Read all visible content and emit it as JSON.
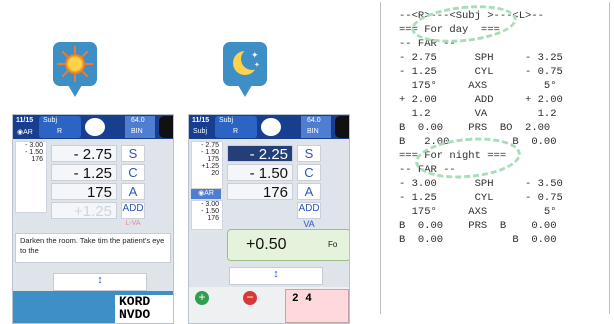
{
  "colors": {
    "accent": "#3d8fc6",
    "screen_bar": "#173e8f",
    "tab": "#2c64c6",
    "highlight": "#243e7a",
    "dash": "#a9ddb8"
  },
  "day_badge": {
    "icon": "sun-icon"
  },
  "night_badge": {
    "icon": "moon-icon"
  },
  "day_screen": {
    "date": "11/15",
    "tag": "◉AR",
    "subj": "Subj",
    "subj_r": "R",
    "bin_val": "64.0",
    "bin_label": "BIN",
    "ar_left": [
      "- 3.00",
      "- 1.50",
      "176"
    ],
    "rows": [
      {
        "value": "- 2.75",
        "label": "S"
      },
      {
        "value": "- 1.25",
        "label": "C"
      },
      {
        "value": "175",
        "label": "A"
      },
      {
        "value": "+1.25",
        "label": "ADD"
      }
    ],
    "va_label": "L-VA",
    "message": "Darken the room. Take tim the patient's eye to the",
    "arrow": "↕",
    "kord": "KORD",
    "nvdo": "NVDO"
  },
  "night_screen": {
    "date": "11/15",
    "subj": "Subj",
    "subj_r": "R",
    "bin_val": "64.0",
    "bin_label": "BIN",
    "subj_left": [
      "- 2.75",
      "- 1.50",
      "175",
      "+1.25",
      "20"
    ],
    "ar_tag": "◉AR",
    "ar_left": [
      "- 3.00",
      "- 1.50",
      "176"
    ],
    "rows": [
      {
        "value": "- 2.25",
        "label": "S"
      },
      {
        "value": "- 1.50",
        "label": "C"
      },
      {
        "value": "176",
        "label": "A"
      }
    ],
    "add_label": "ADD",
    "va_label": "VA",
    "add_value": "+0.50",
    "add_suffix": "Fo",
    "arrow": "↕",
    "plus": "+",
    "minus": "−",
    "chart_nums": "2 4"
  },
  "printout": {
    "header": "--<R>---<Subj >---<L>--",
    "day_title": "=== For day  ===",
    "far": "-- FAR --",
    "day_lines": [
      "- 2.75      SPH     - 3.25",
      "- 1.25      CYL     - 0.75",
      "  175°     AXS         5°",
      "+ 2.00      ADD     + 2.00",
      "  1.2       VA        1.2",
      "B  0.00    PRS  BO  2.00",
      "B   2.00          B  0.00"
    ],
    "night_title": "=== For night ===",
    "night_far": "-- FAR --",
    "night_lines": [
      "- 3.00      SPH     - 3.50",
      "- 1.25      CYL     - 0.75",
      "  175°     AXS         5°",
      "B  0.00    PRS  B    0.00",
      "B  0.00           B  0.00"
    ]
  }
}
